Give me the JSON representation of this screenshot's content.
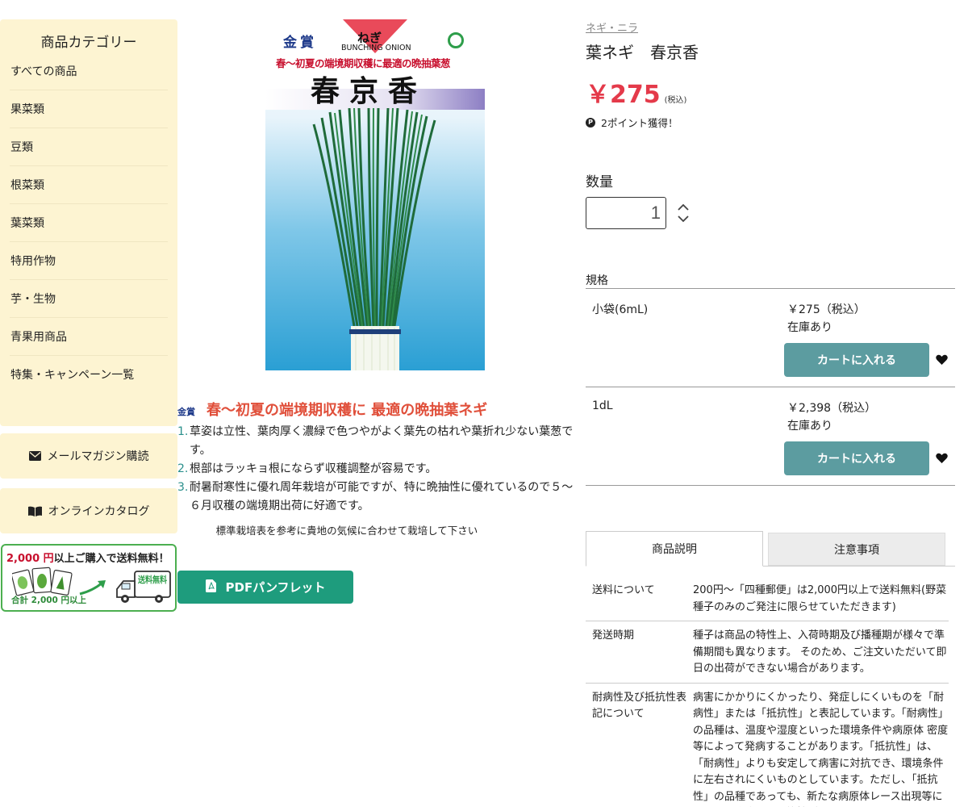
{
  "sidebar": {
    "category_title": "商品カテゴリー",
    "categories": [
      "すべての商品",
      "果菜類",
      "豆類",
      "根菜類",
      "葉菜類",
      "特用作物",
      "芋・生物",
      "青果用商品",
      "特集・キャンペーン一覧"
    ],
    "mail_magazine": "メールマガジン購読",
    "online_catalog": "オンラインカタログ",
    "banner": {
      "amount": "2,000 円",
      "text": "以上ご購入で送料無料！",
      "sub": "合計 2,000 円以上",
      "truck_label": "送料無料"
    }
  },
  "package": {
    "award": "金賞",
    "kana": "ねぎ",
    "english": "BUNCHING ONION",
    "subtitle": "春〜初夏の端境期収穫に最適の晩抽葉葱",
    "name": "春京香"
  },
  "description": {
    "award": "金賞",
    "title": "春〜初夏の端境期収穫に 最適の晩抽葉ネギ",
    "items": [
      {
        "num": "1.",
        "text": "草姿は立性、葉肉厚く濃緑で色つやがよく葉先の枯れや葉折れ少ない葉葱です。"
      },
      {
        "num": "2.",
        "text": "根部はラッキョ根にならず収穫調整が容易です。"
      },
      {
        "num": "3.",
        "text": "耐暑耐寒性に優れ周年栽培が可能ですが、特に晩抽性に優れているので５〜６月収穫の端境期出荷に好適です。"
      }
    ],
    "note": "標準栽培表を参考に貴地の気候に合わせて栽培して下さい",
    "pdf_button": "PDFパンフレット"
  },
  "product": {
    "breadcrumb": "ネギ・ニラ",
    "title": "葉ネギ　春京香",
    "price": "￥275",
    "price_tax": "(税込)",
    "points": "2ポイント獲得！",
    "points_icon": "P",
    "qty_label": "数量",
    "qty_value": "1",
    "spec_label": "規格",
    "variants": [
      {
        "name": "小袋(6mL)",
        "price": "￥275（税込）",
        "stock": "在庫あり",
        "cart": "カートに入れる"
      },
      {
        "name": "1dL",
        "price": "￥2,398（税込）",
        "stock": "在庫あり",
        "cart": "カートに入れる"
      }
    ]
  },
  "tabs": [
    "商品説明",
    "注意事項"
  ],
  "info_rows": [
    {
      "key": "送料について",
      "value": "200円〜「四種郵便」は2,000円以上で送料無料(野菜種子のみのご発注に限らせていただきます)"
    },
    {
      "key": "発送時期",
      "value": "種子は商品の特性上、入荷時期及び播種期が様々で準備期間も異なります。 そのため、ご注文いただいて即日の出荷ができない場合があります。"
    },
    {
      "key": "耐病性及び抵抗性表記について",
      "value": "病害にかかりにくかったり、発症しにくいものを「耐病性」または「抵抗性」と表記しています。「耐病性」の品種は、温度や湿度といった環境条件や病原体 密度等によって発病することがあります。「抵抗性」は、「耐病性」よりも安定して病害に対抗でき、環境条件に左右されにくいものとしています。ただし、「抵抗性」の品種であっても、新たな病原体レース出現等によっては発病する可能性があります。"
    }
  ],
  "colors": {
    "sidebar_bg": "#fdf4d2",
    "price": "#e43a4a",
    "cart_button": "#5c9ca0",
    "pdf_button": "#1e9c7d",
    "desc_title": "#e04f3a"
  }
}
